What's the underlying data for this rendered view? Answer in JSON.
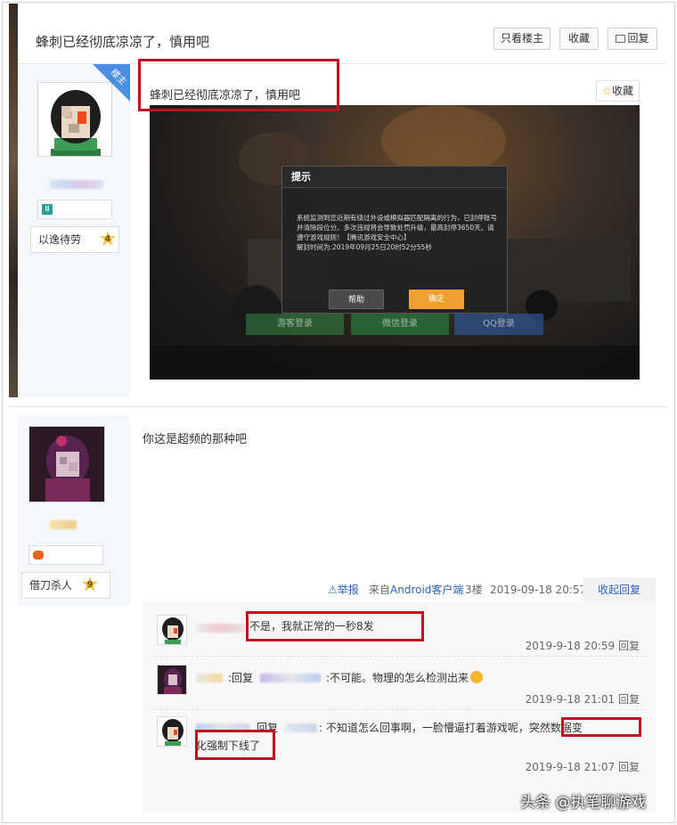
{
  "header": {
    "title": "蜂刺已经彻底凉凉了，慎用吧",
    "only_op_label": "只看楼主",
    "favorite_label": "收藏",
    "reply_label": "回复"
  },
  "post1": {
    "op_badge": "楼主",
    "rank_title": "以逸待劳",
    "level": "4",
    "title": "蜂刺已经彻底凉凉了，慎用吧",
    "favorite_label": "收藏",
    "game_dialog": {
      "title": "提示",
      "message": "系统监测到您近期有绕过外设或模拟器匹配隔离的行为，已封停账号并清除段位分。多次违规将会导致处罚升级，最高封停3650天。请遵守游戏规则！【腾讯游戏安全中心】",
      "unban_time": "解封时间为:2019年09月25日20时52分55秒",
      "help_button": "帮助",
      "ok_button": "确定",
      "login_buttons": [
        "游客登录",
        "微信登录",
        "QQ登录"
      ]
    }
  },
  "post2": {
    "rank_title": "借刀杀人",
    "level": "9",
    "content": "你这是超频的那种吧",
    "report_label": "举报",
    "source": "来自Android客户端",
    "floor": "3楼",
    "time": "2019-09-18 20:57",
    "collapse_label": "收起回复"
  },
  "comments": [
    {
      "text": "不是，我就正常的一秒8发",
      "time": "2019-9-18 20:59",
      "reply_label": "回复"
    },
    {
      "prefix": ":回复",
      "text": ":不可能。物理的怎么检测出来",
      "time": "2019-9-18 21:01",
      "reply_label": "回复"
    },
    {
      "prefix": "回复",
      "text": ": 不知道怎么回事啊，一脸懵逼打着游戏呢，",
      "highlight": "突然数据变",
      "line2": "化强制下线了",
      "time": "2019-9-18 21:07",
      "reply_label": "回复"
    }
  ],
  "watermark": "头条 @执笔聊游戏",
  "colors": {
    "link_blue": "#2d64b3",
    "highlight_red": "#c0121d",
    "op_badge_blue": "#4a8fe2",
    "dialog_orange": "#f0a030"
  }
}
